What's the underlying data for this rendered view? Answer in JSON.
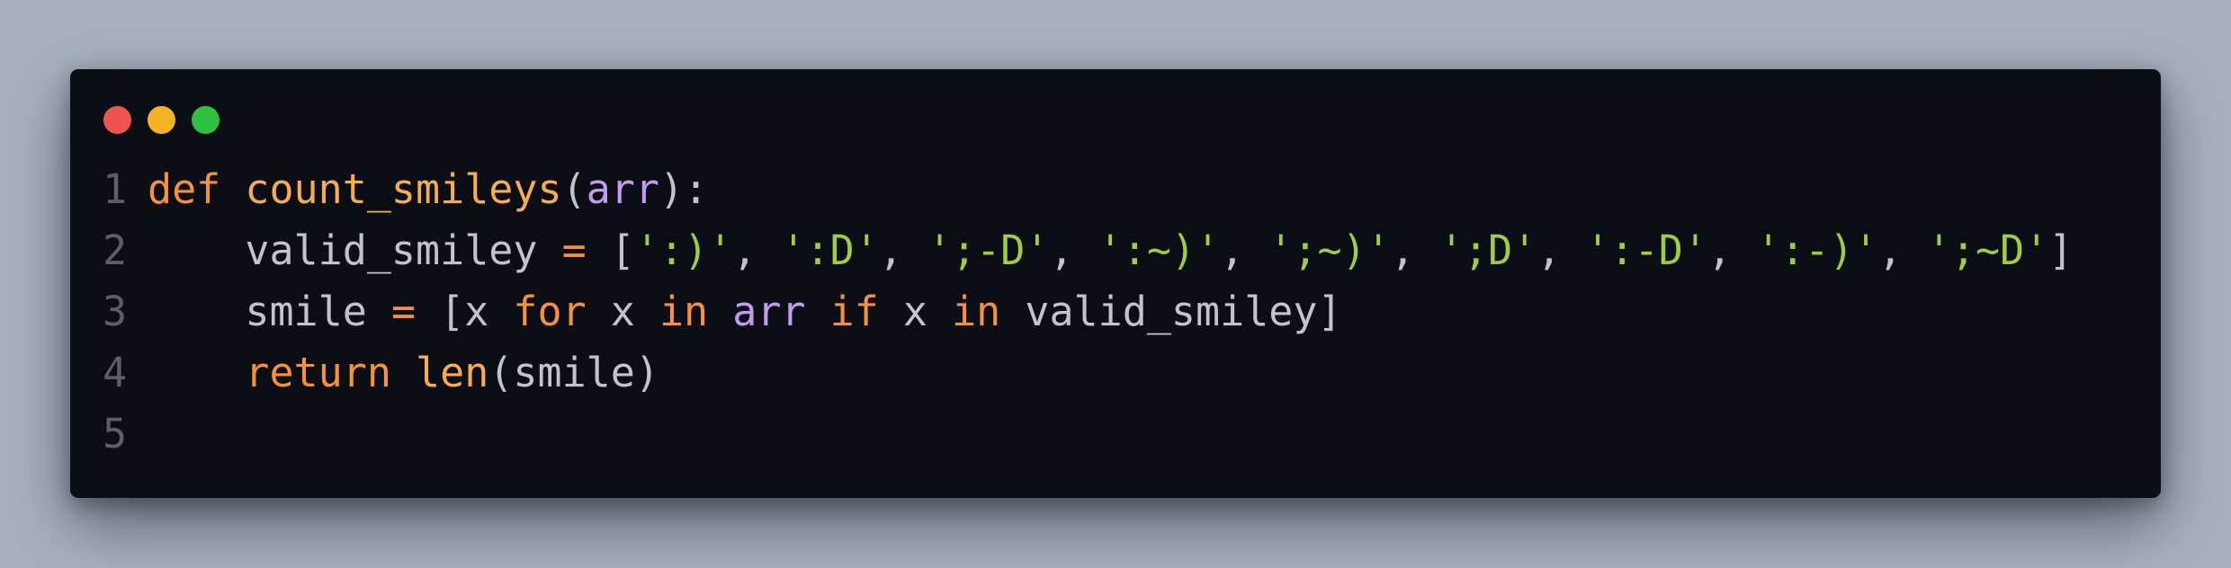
{
  "window": {
    "background": "#0b0e15",
    "controls": [
      {
        "name": "close",
        "color": "#f0544e"
      },
      {
        "name": "minimize",
        "color": "#f5b428"
      },
      {
        "name": "maximize",
        "color": "#2fc03f"
      }
    ]
  },
  "theme": {
    "keyword": "#f6913a",
    "function": "#f6ad4f",
    "param": "#c59af0",
    "string": "#9fcf3f",
    "text": "#c2c4c8",
    "line_number": "#5b6068",
    "operator": "#f6913a"
  },
  "code": {
    "lines": [
      {
        "number": "1",
        "tokens": [
          {
            "t": "def",
            "c": "keyword"
          },
          {
            "t": " ",
            "c": "text"
          },
          {
            "t": "count_smileys",
            "c": "function"
          },
          {
            "t": "(",
            "c": "text"
          },
          {
            "t": "arr",
            "c": "param"
          },
          {
            "t": "):",
            "c": "text"
          }
        ]
      },
      {
        "number": "2",
        "tokens": [
          {
            "t": "    valid_smiley ",
            "c": "text"
          },
          {
            "t": "=",
            "c": "operator"
          },
          {
            "t": " [",
            "c": "text"
          },
          {
            "t": "':)'",
            "c": "string"
          },
          {
            "t": ", ",
            "c": "text"
          },
          {
            "t": "':D'",
            "c": "string"
          },
          {
            "t": ", ",
            "c": "text"
          },
          {
            "t": "';-D'",
            "c": "string"
          },
          {
            "t": ", ",
            "c": "text"
          },
          {
            "t": "':~)'",
            "c": "string"
          },
          {
            "t": ", ",
            "c": "text"
          },
          {
            "t": "';~)'",
            "c": "string"
          },
          {
            "t": ", ",
            "c": "text"
          },
          {
            "t": "';D'",
            "c": "string"
          },
          {
            "t": ", ",
            "c": "text"
          },
          {
            "t": "':-D'",
            "c": "string"
          },
          {
            "t": ", ",
            "c": "text"
          },
          {
            "t": "':-)'",
            "c": "string"
          },
          {
            "t": ", ",
            "c": "text"
          },
          {
            "t": "';~D'",
            "c": "string"
          },
          {
            "t": "]",
            "c": "text"
          }
        ]
      },
      {
        "number": "3",
        "tokens": [
          {
            "t": "    smile ",
            "c": "text"
          },
          {
            "t": "=",
            "c": "operator"
          },
          {
            "t": " [x ",
            "c": "text"
          },
          {
            "t": "for",
            "c": "keyword"
          },
          {
            "t": " x ",
            "c": "text"
          },
          {
            "t": "in",
            "c": "keyword"
          },
          {
            "t": " ",
            "c": "text"
          },
          {
            "t": "arr",
            "c": "param"
          },
          {
            "t": " ",
            "c": "text"
          },
          {
            "t": "if",
            "c": "keyword"
          },
          {
            "t": " x ",
            "c": "text"
          },
          {
            "t": "in",
            "c": "keyword"
          },
          {
            "t": " valid_smiley]",
            "c": "text"
          }
        ]
      },
      {
        "number": "4",
        "tokens": [
          {
            "t": "    ",
            "c": "text"
          },
          {
            "t": "return",
            "c": "keyword"
          },
          {
            "t": " ",
            "c": "text"
          },
          {
            "t": "len",
            "c": "function"
          },
          {
            "t": "(smile)",
            "c": "text"
          }
        ]
      },
      {
        "number": "5",
        "tokens": []
      }
    ]
  }
}
